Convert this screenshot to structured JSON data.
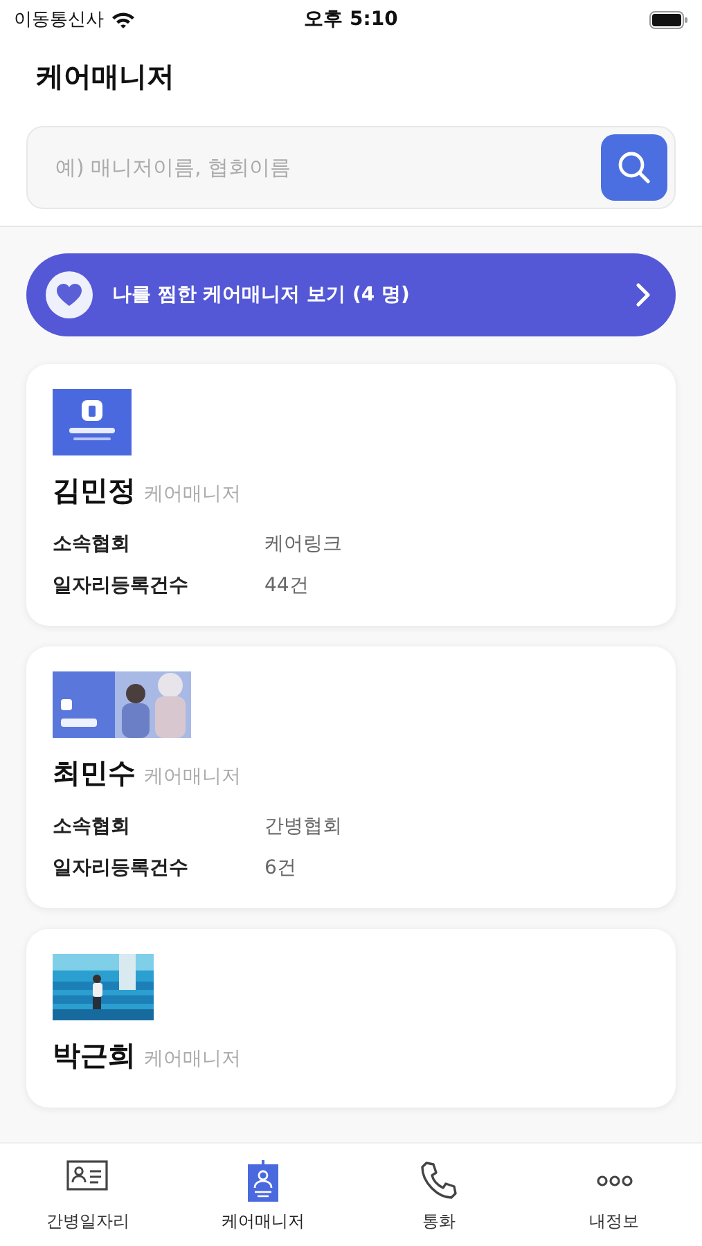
{
  "status_bar": {
    "carrier": "이동통신사",
    "time": "오후 5:10"
  },
  "header": {
    "title": "케어매니저"
  },
  "search": {
    "placeholder": "예) 매니저이름, 협회이름"
  },
  "favorites_banner": {
    "label": "나를 찜한 케어매니저 보기 (4 명)"
  },
  "managers": [
    {
      "image": {
        "kind": "picture"
      },
      "name": "김민정",
      "role": "케어매니저",
      "rows": [
        {
          "label": "소속협회",
          "value": "케어링크"
        },
        {
          "label": "일자리등록건수",
          "value": "44건"
        }
      ]
    },
    {
      "image": {
        "kind": "picture"
      },
      "name": "최민수",
      "role": "케어매니저",
      "rows": [
        {
          "label": "소속협회",
          "value": "간병협회"
        },
        {
          "label": "일자리등록건수",
          "value": "6건"
        }
      ]
    },
    {
      "image": {
        "kind": "picture"
      },
      "name": "박근희",
      "role": "케어매니저"
    }
  ],
  "tab_bar": [
    {
      "label": "간병일자리",
      "selected": false
    },
    {
      "label": "케어매니저",
      "selected": true
    },
    {
      "label": "통화",
      "selected": false
    },
    {
      "label": "내정보",
      "selected": false
    }
  ]
}
